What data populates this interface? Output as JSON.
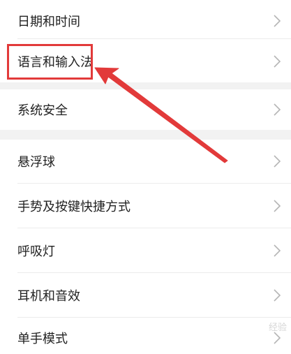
{
  "settings": {
    "items": [
      {
        "label": "日期和时间"
      },
      {
        "label": "语言和输入法"
      },
      {
        "label": "系统安全"
      },
      {
        "label": "悬浮球"
      },
      {
        "label": "手势及按键快捷方式"
      },
      {
        "label": "呼吸灯"
      },
      {
        "label": "耳机和音效"
      },
      {
        "label": "单手模式"
      }
    ]
  },
  "annotation": {
    "color": "#e23a3a"
  },
  "watermark": {
    "text": "经验"
  }
}
